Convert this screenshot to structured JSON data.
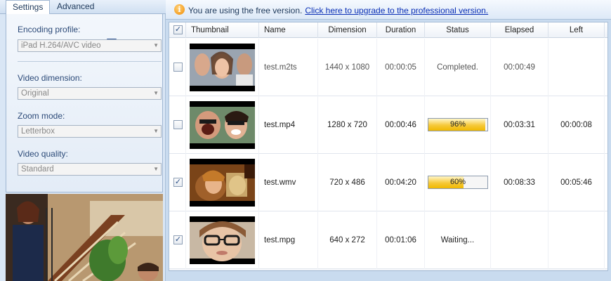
{
  "tabs": {
    "settings": "Settings",
    "advanced": "Advanced"
  },
  "settings": {
    "encoding_profile_label": "Encoding profile:",
    "encoding_profile_value": "iPad H.264/AVC video",
    "video_dimension_label": "Video dimension:",
    "video_dimension_value": "Original",
    "zoom_mode_label": "Zoom mode:",
    "zoom_mode_value": "Letterbox",
    "video_quality_label": "Video quality:",
    "video_quality_value": "Standard"
  },
  "banner": {
    "text": "You are using the free version.",
    "link": "Click here to upgrade to the professional version."
  },
  "grid": {
    "headers": {
      "thumbnail": "Thumbnail",
      "name": "Name",
      "dimension": "Dimension",
      "duration": "Duration",
      "status": "Status",
      "elapsed": "Elapsed",
      "left": "Left"
    },
    "rows": [
      {
        "checked": false,
        "name": "test.m2ts",
        "dimension": "1440 x 1080",
        "duration": "00:00:05",
        "status": "Completed.",
        "progress": null,
        "elapsed": "00:00:49",
        "left": ""
      },
      {
        "checked": false,
        "name": "test.mp4",
        "dimension": "1280 x 720",
        "duration": "00:00:46",
        "status": "96%",
        "progress": 0.96,
        "elapsed": "00:03:31",
        "left": "00:00:08"
      },
      {
        "checked": true,
        "name": "test.wmv",
        "dimension": "720 x 486",
        "duration": "00:04:20",
        "status": "60%",
        "progress": 0.6,
        "elapsed": "00:08:33",
        "left": "00:05:46"
      },
      {
        "checked": true,
        "name": "test.mpg",
        "dimension": "640 x 272",
        "duration": "00:01:06",
        "status": "Waiting...",
        "progress": null,
        "elapsed": "",
        "left": ""
      }
    ]
  },
  "colors": {
    "accent": "#1e395b",
    "link": "#0a2fb5",
    "progress": "#f6c93a"
  }
}
